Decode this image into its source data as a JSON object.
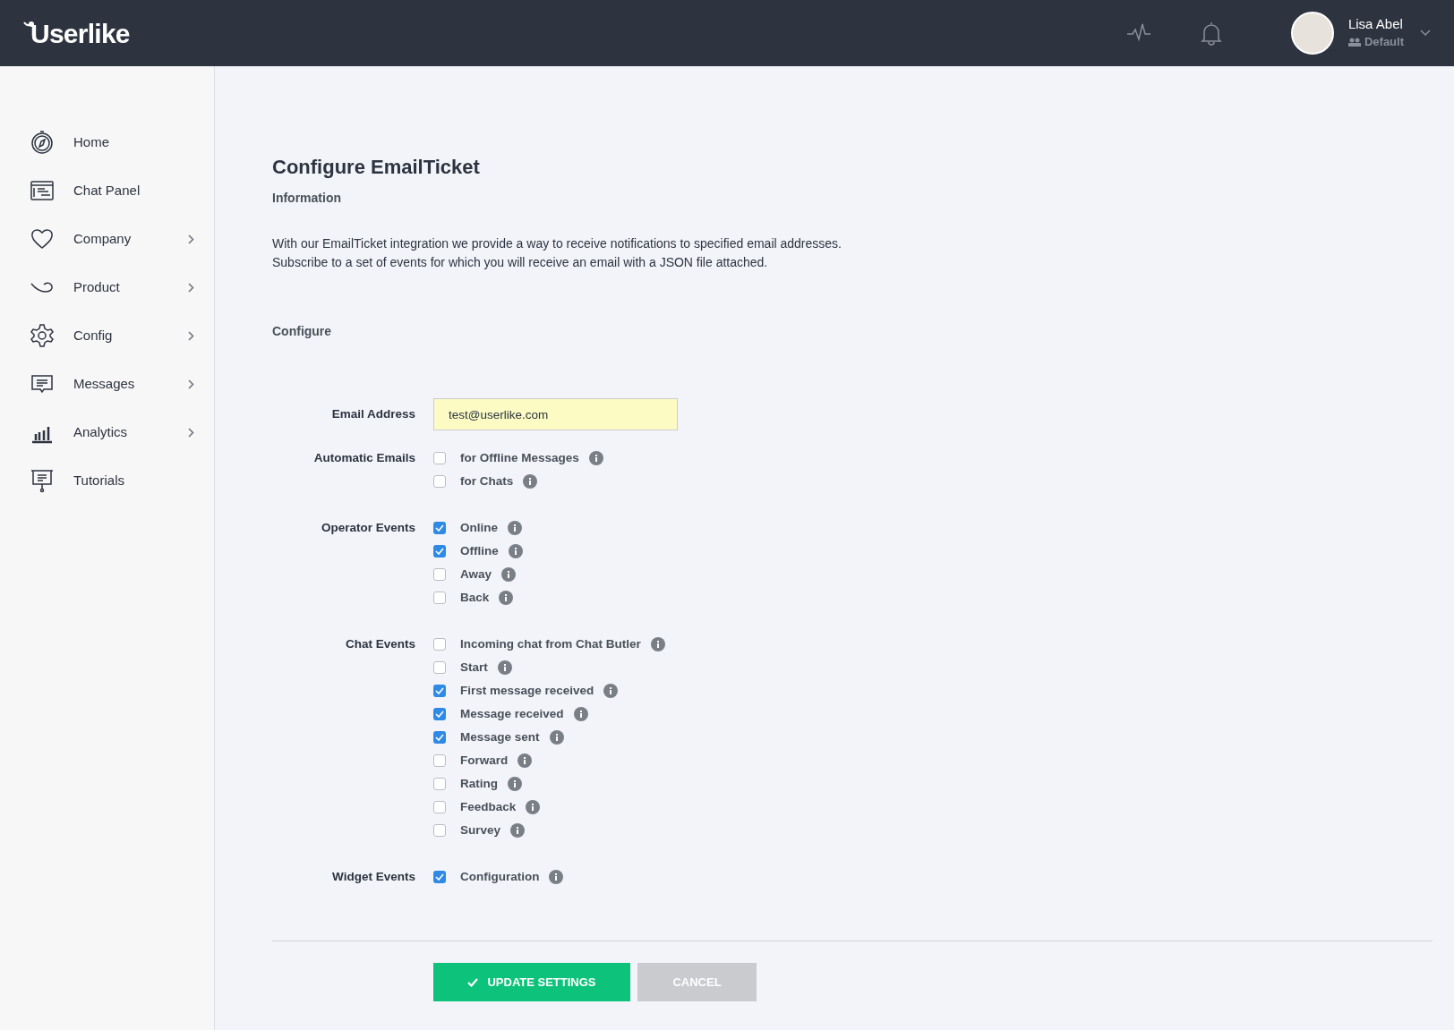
{
  "header": {
    "logo": "Userlike",
    "user": {
      "name": "Lisa Abel",
      "role": "Default"
    }
  },
  "sidebar": {
    "items": [
      {
        "label": "Home",
        "has_submenu": false
      },
      {
        "label": "Chat Panel",
        "has_submenu": false
      },
      {
        "label": "Company",
        "has_submenu": true
      },
      {
        "label": "Product",
        "has_submenu": true
      },
      {
        "label": "Config",
        "has_submenu": true
      },
      {
        "label": "Messages",
        "has_submenu": true
      },
      {
        "label": "Analytics",
        "has_submenu": true
      },
      {
        "label": "Tutorials",
        "has_submenu": false
      }
    ]
  },
  "page": {
    "title": "Configure EmailTicket",
    "information_heading": "Information",
    "description": [
      "With our EmailTicket integration we provide a way to receive notifications to specified email addresses.",
      "Subscribe to a set of events for which you will receive an email with a JSON file attached."
    ],
    "configure_heading": "Configure",
    "email": {
      "label": "Email Address",
      "value": "test@userlike.com"
    },
    "groups": [
      {
        "label": "Automatic Emails",
        "options": [
          {
            "label": "for Offline Messages",
            "checked": false
          },
          {
            "label": "for Chats",
            "checked": false
          }
        ]
      },
      {
        "label": "Operator Events",
        "options": [
          {
            "label": "Online",
            "checked": true
          },
          {
            "label": "Offline",
            "checked": true
          },
          {
            "label": "Away",
            "checked": false
          },
          {
            "label": "Back",
            "checked": false
          }
        ]
      },
      {
        "label": "Chat Events",
        "options": [
          {
            "label": "Incoming chat from Chat Butler",
            "checked": false
          },
          {
            "label": "Start",
            "checked": false
          },
          {
            "label": "First message received",
            "checked": true
          },
          {
            "label": "Message received",
            "checked": true
          },
          {
            "label": "Message sent",
            "checked": true
          },
          {
            "label": "Forward",
            "checked": false
          },
          {
            "label": "Rating",
            "checked": false
          },
          {
            "label": "Feedback",
            "checked": false
          },
          {
            "label": "Survey",
            "checked": false
          }
        ]
      },
      {
        "label": "Widget Events",
        "options": [
          {
            "label": "Configuration",
            "checked": true
          }
        ]
      }
    ],
    "buttons": [
      {
        "label": "UPDATE SETTINGS",
        "kind": "primary"
      },
      {
        "label": "CANCEL",
        "kind": "secondary"
      }
    ]
  }
}
